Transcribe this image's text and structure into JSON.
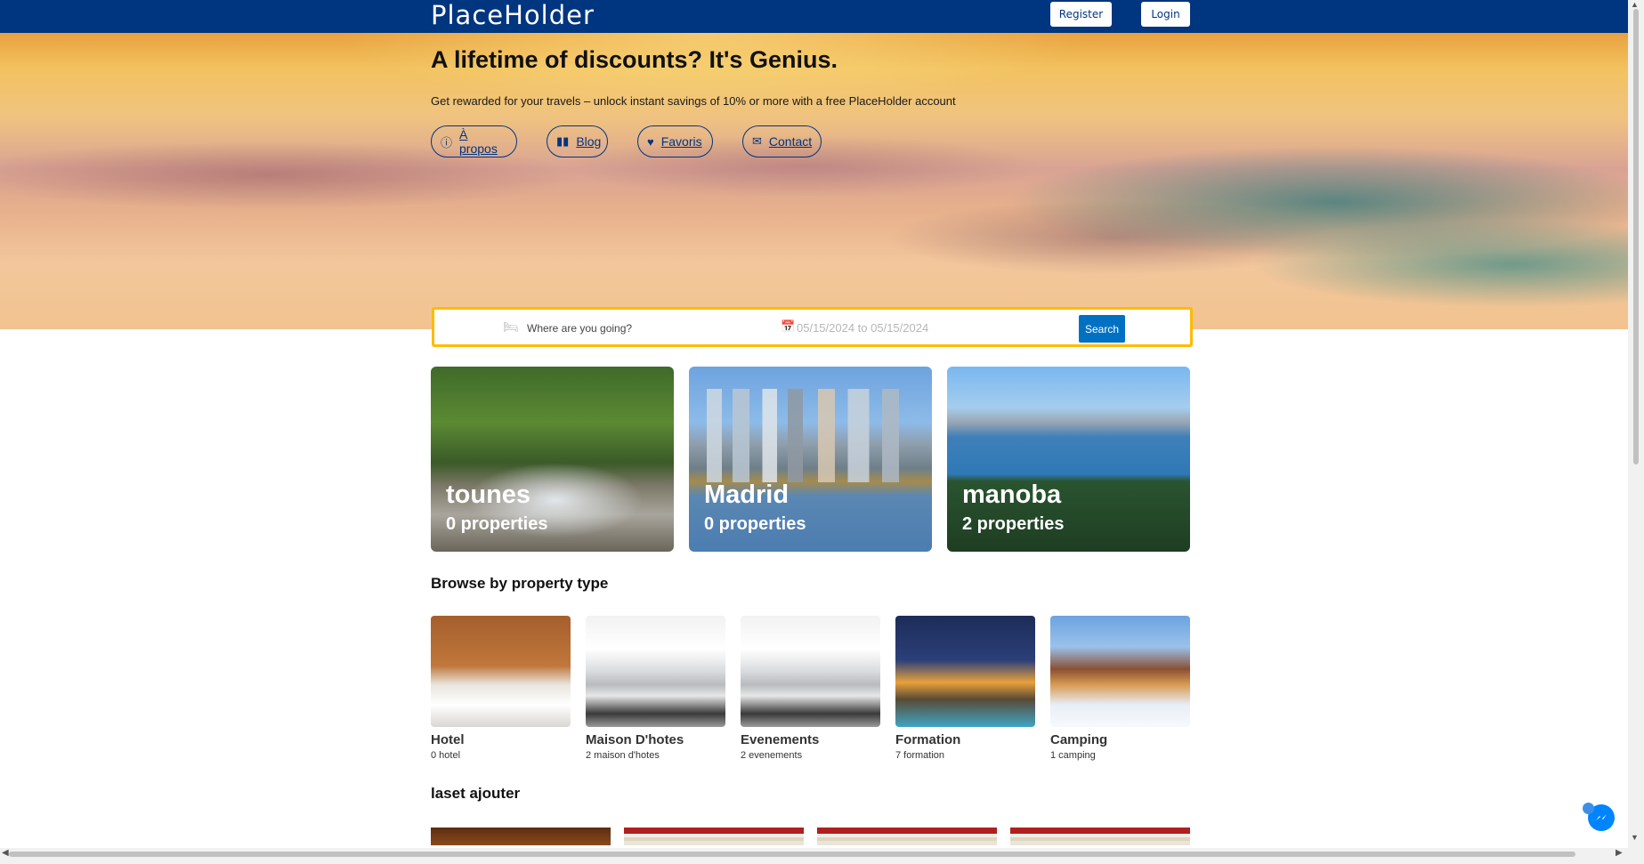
{
  "header": {
    "brand": "PlaceHolder",
    "register_label": "Register",
    "login_label": "Login"
  },
  "hero": {
    "title": "A lifetime of discounts? It's Genius.",
    "subtitle": "Get rewarded for your travels – unlock instant savings of 10% or more with a free PlaceHolder account",
    "links": [
      {
        "label": "À propos",
        "icon": "info-circle-icon"
      },
      {
        "label": "Blog",
        "icon": "book-icon"
      },
      {
        "label": "Favoris",
        "icon": "heart-icon"
      },
      {
        "label": "Contact",
        "icon": "envelope-icon"
      }
    ]
  },
  "search": {
    "destination_placeholder": "Where are you going?",
    "dates_placeholder": "05/15/2024 to 05/15/2024",
    "button_label": "Search"
  },
  "cities": [
    {
      "name": "tounes",
      "count": "0 properties"
    },
    {
      "name": "Madrid",
      "count": "0 properties"
    },
    {
      "name": "manoba",
      "count": "2 properties"
    }
  ],
  "property_types": {
    "title": "Browse by property type",
    "items": [
      {
        "name": "Hotel",
        "count": "0 hotel"
      },
      {
        "name": "Maison D'hotes",
        "count": "2 maison d'hotes"
      },
      {
        "name": "Evenements",
        "count": "2 evenements"
      },
      {
        "name": "Formation",
        "count": "7 formation"
      },
      {
        "name": "Camping",
        "count": "1 camping"
      }
    ]
  },
  "latest": {
    "title": "laset ajouter"
  },
  "colors": {
    "brand_blue": "#003580",
    "search_border": "#febb02",
    "search_button": "#0071c2"
  }
}
